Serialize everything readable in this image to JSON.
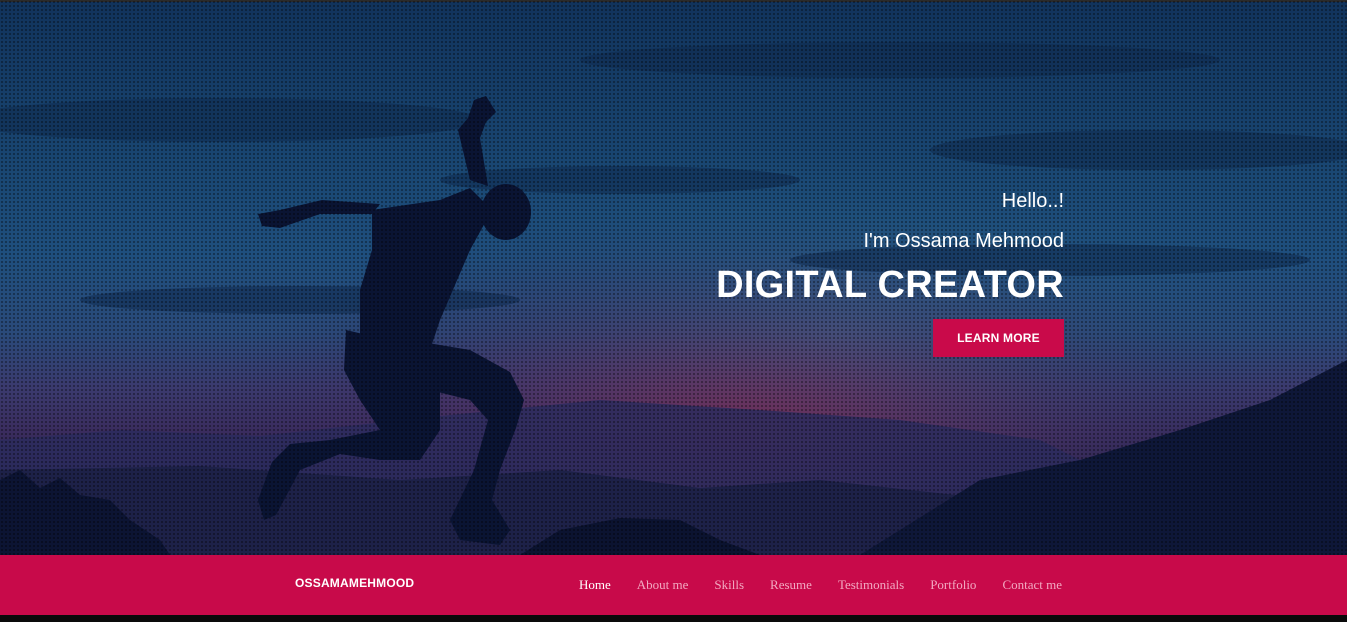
{
  "hero": {
    "greeting": "Hello..!",
    "intro": "I'm Ossama Mehmood",
    "headline": "DIGITAL CREATOR",
    "cta_label": "LEARN MORE"
  },
  "nav": {
    "brand": "OSSAMAMEHMOOD",
    "items": [
      {
        "label": "Home",
        "active": true
      },
      {
        "label": "About me",
        "active": false
      },
      {
        "label": "Skills",
        "active": false
      },
      {
        "label": "Resume",
        "active": false
      },
      {
        "label": "Testimonials",
        "active": false
      },
      {
        "label": "Portfolio",
        "active": false
      },
      {
        "label": "Contact me",
        "active": false
      }
    ]
  },
  "colors": {
    "accent": "#c80a4a",
    "nav_text": "#f2a9c1",
    "hero_sky": "#1a4874"
  }
}
